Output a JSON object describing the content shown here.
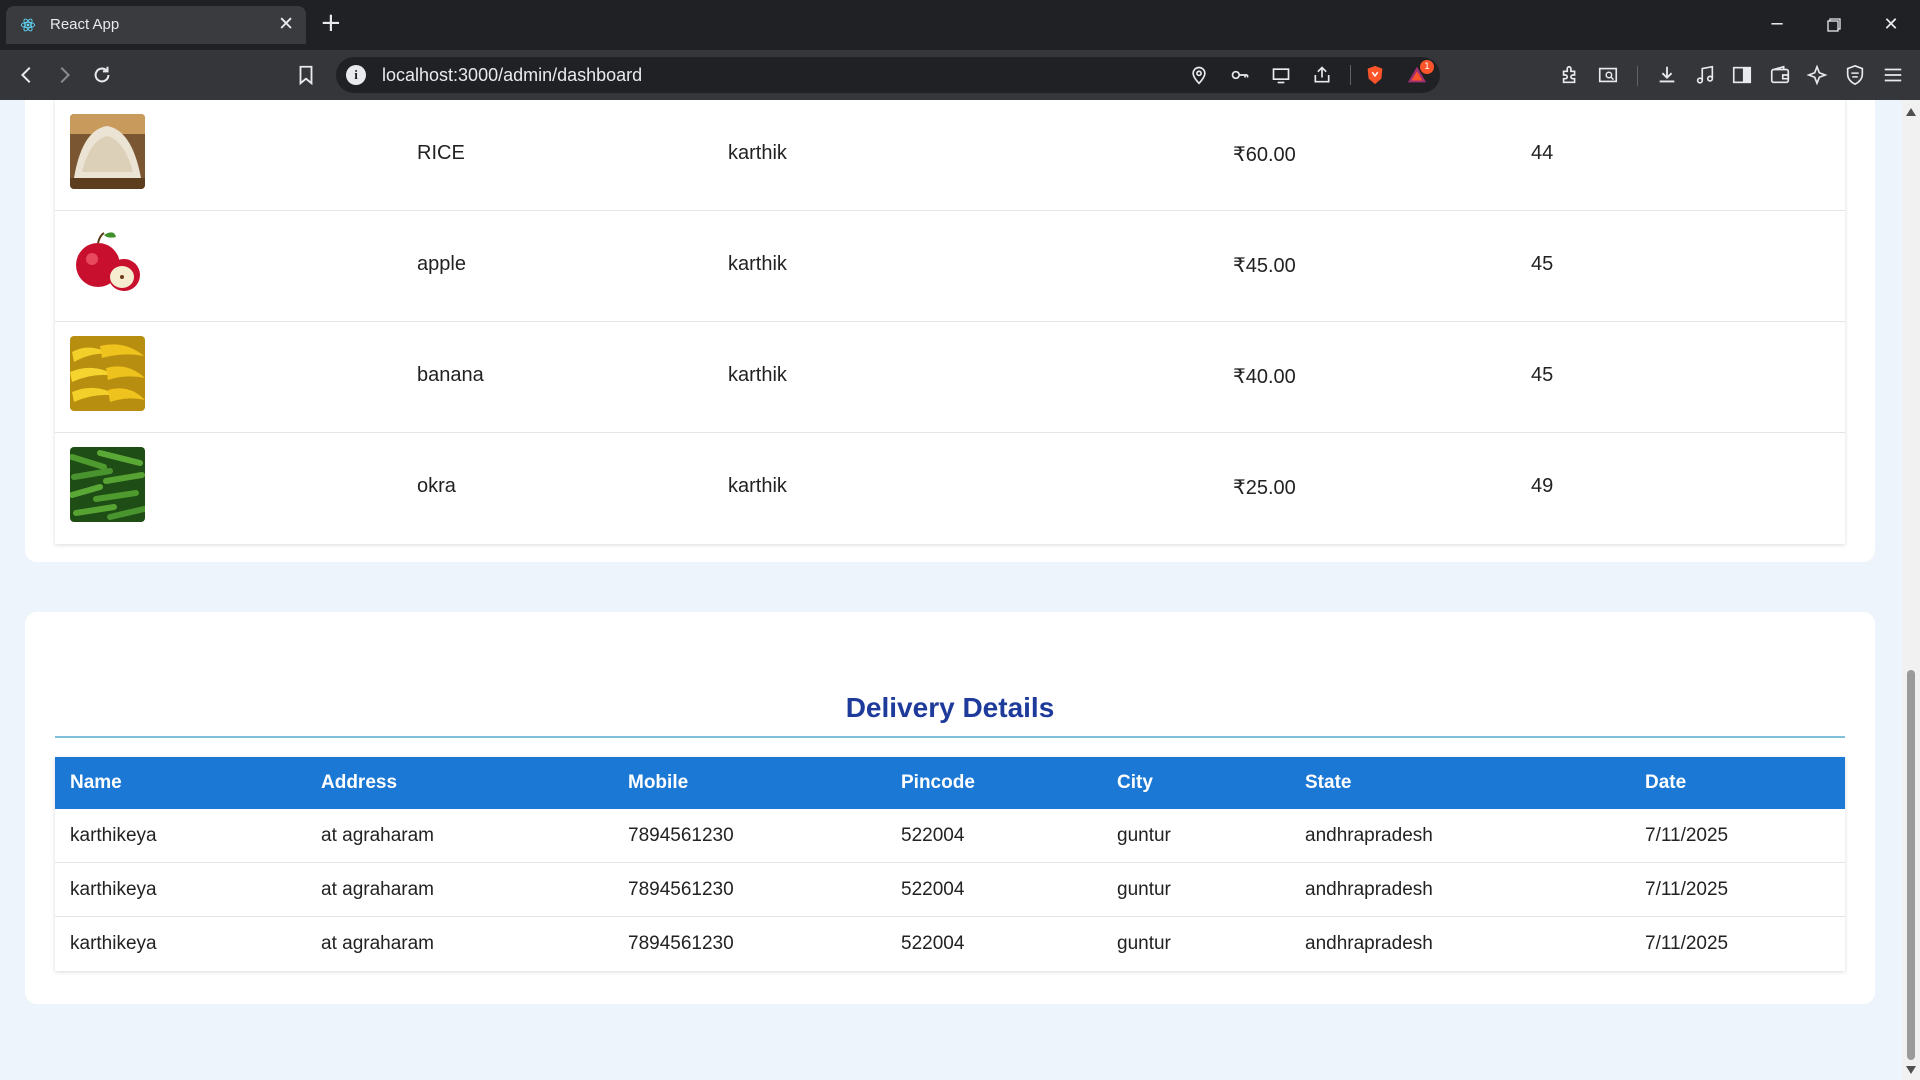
{
  "browser": {
    "tab_title": "React App",
    "url": "localhost:3000/admin/dashboard",
    "notification_count": "1",
    "brand_color": "#fb542b"
  },
  "products": [
    {
      "image": "rice-image",
      "name": "RICE",
      "seller": "karthik",
      "price": "₹60.00",
      "quantity": "44"
    },
    {
      "image": "apple-image",
      "name": "apple",
      "seller": "karthik",
      "price": "₹45.00",
      "quantity": "45"
    },
    {
      "image": "banana-image",
      "name": "banana",
      "seller": "karthik",
      "price": "₹40.00",
      "quantity": "45"
    },
    {
      "image": "okra-image",
      "name": "okra",
      "seller": "karthik",
      "price": "₹25.00",
      "quantity": "49"
    }
  ],
  "delivery": {
    "title": "Delivery Details",
    "header_color": "#1b78d4",
    "title_color": "#1e3a9a",
    "columns": [
      "Name",
      "Address",
      "Mobile",
      "Pincode",
      "City",
      "State",
      "Date"
    ],
    "rows": [
      [
        "karthikeya",
        "at agraharam",
        "7894561230",
        "522004",
        "guntur",
        "andhrapradesh",
        "7/11/2025"
      ],
      [
        "karthikeya",
        "at agraharam",
        "7894561230",
        "522004",
        "guntur",
        "andhrapradesh",
        "7/11/2025"
      ],
      [
        "karthikeya",
        "at agraharam",
        "7894561230",
        "522004",
        "guntur",
        "andhrapradesh",
        "7/11/2025"
      ]
    ]
  }
}
